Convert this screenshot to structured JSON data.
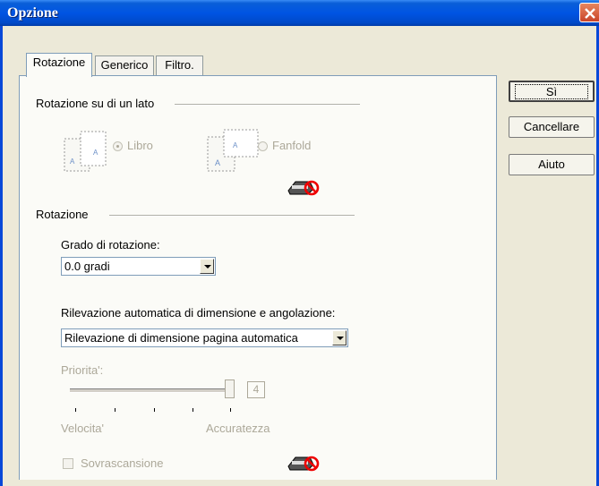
{
  "window": {
    "title": "Opzione"
  },
  "tabs": [
    {
      "label": "Rotazione"
    },
    {
      "label": "Generico"
    },
    {
      "label": "Filtro."
    }
  ],
  "side_buttons": {
    "ok": "Sì",
    "cancel": "Cancellare",
    "help": "Aiuto"
  },
  "single_side": {
    "heading": "Rotazione su di un lato",
    "options": [
      {
        "label": "Libro",
        "selected": true
      },
      {
        "label": "Fanfold",
        "selected": false
      }
    ]
  },
  "rotation": {
    "heading": "Rotazione",
    "degree_label": "Grado di rotazione:",
    "degree_value": "0.0 gradi",
    "auto_label": "Rilevazione automatica di dimensione e angolazione:",
    "auto_value": "Rilevazione di dimensione pagina automatica",
    "priority_label": "Priorita':",
    "priority_value": "4",
    "slider_min_label": "Velocita'",
    "slider_max_label": "Accuratezza",
    "overscan_label": "Sovrascansione",
    "overscan_checked": false
  },
  "icons": {
    "close": "close-icon",
    "book": "book-page-icon",
    "fanfold": "fanfold-page-icon",
    "unavailable": "no-scanner-icon"
  }
}
